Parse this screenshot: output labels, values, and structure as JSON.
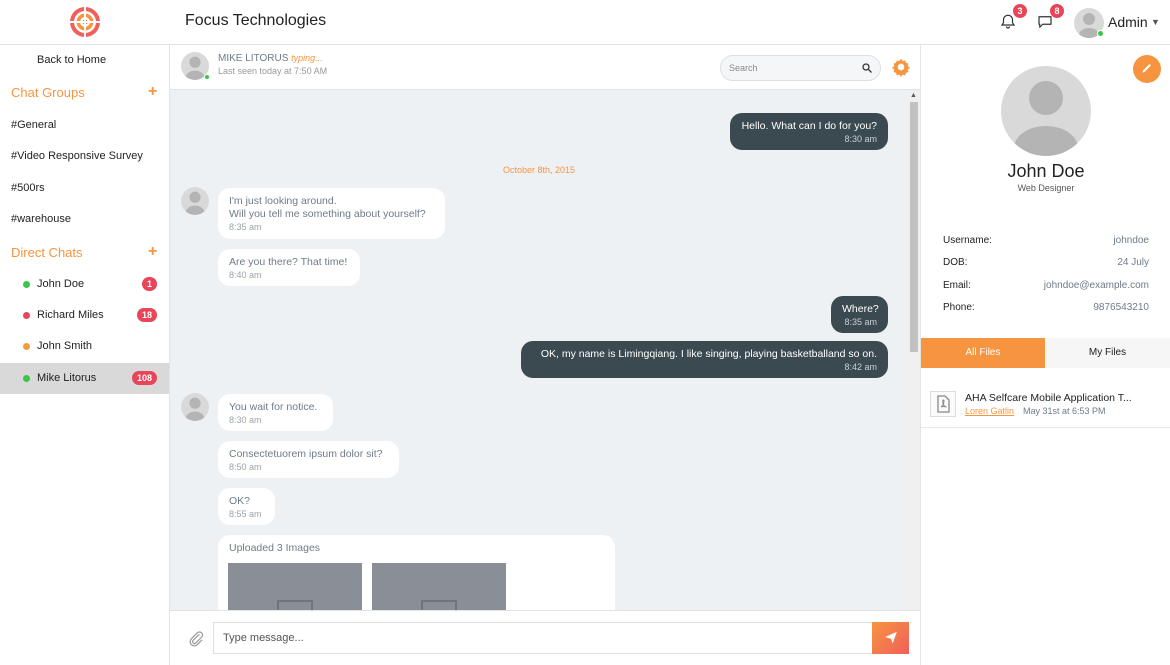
{
  "app": {
    "title": "Focus Technologies"
  },
  "topbar": {
    "notifications_count": "3",
    "messages_count": "8",
    "user_name": "Admin"
  },
  "sidebar": {
    "back_label": "Back to Home",
    "groups_heading": "Chat Groups",
    "groups": [
      "#General",
      "#Video Responsive Survey",
      "#500rs",
      "#warehouse"
    ],
    "direct_heading": "Direct Chats",
    "chats": [
      {
        "name": "John Doe",
        "count": "1",
        "status_color": "#3bc54b"
      },
      {
        "name": "Richard Miles",
        "count": "18",
        "status_color": "#e8455a"
      },
      {
        "name": "John Smith",
        "count": "",
        "status_color": "#f79a3a"
      },
      {
        "name": "Mike Litorus",
        "count": "108",
        "status_color": "#3bc54b",
        "active": true
      }
    ]
  },
  "chat": {
    "peer_name": "MIKE LITORUS",
    "peer_status": "typing...",
    "last_seen": "Last seen today at 7:50 AM",
    "search_placeholder": "Search",
    "date_separator": "October 8th, 2015",
    "messages": [
      {
        "dir": "out",
        "text": "Hello. What can I do for you?",
        "time": "8:30 am"
      },
      {
        "dir": "in",
        "text": "I'm just looking around.",
        "text2": "Will you tell me something about yourself?",
        "time": "8:35 am"
      },
      {
        "dir": "in",
        "text": "Are you there? That time!",
        "time": "8:40 am"
      },
      {
        "dir": "out",
        "text": "Where?",
        "time": "8:35 am"
      },
      {
        "dir": "out",
        "text": "OK, my name is Limingqiang. I like singing, playing basketballand so on.",
        "time": "8:42 am"
      },
      {
        "dir": "in",
        "text": "You wait for notice.",
        "time": "8:30 am"
      },
      {
        "dir": "in",
        "text": "Consectetuorem ipsum dolor sit?",
        "time": "8:50 am"
      },
      {
        "dir": "in",
        "text": "OK?",
        "time": "8:55 am"
      },
      {
        "dir": "in",
        "text": "Uploaded 3 Images"
      }
    ],
    "composer_placeholder": "Type message..."
  },
  "profile": {
    "name": "John Doe",
    "role": "Web Designer",
    "fields": [
      {
        "label": "Username:",
        "value": "johndoe"
      },
      {
        "label": "DOB:",
        "value": "24 July"
      },
      {
        "label": "Email:",
        "value": "johndoe@example.com"
      },
      {
        "label": "Phone:",
        "value": "9876543210"
      }
    ],
    "tabs": [
      "All Files",
      "My Files"
    ],
    "file": {
      "name": "AHA Selfcare Mobile Application T...",
      "author": "Loren Gatlin",
      "date": "May 31st at 6:53 PM"
    }
  },
  "colors": {
    "accent": "#f79440",
    "dark_bubble": "#3b4a50",
    "badge": "#e8455a"
  }
}
